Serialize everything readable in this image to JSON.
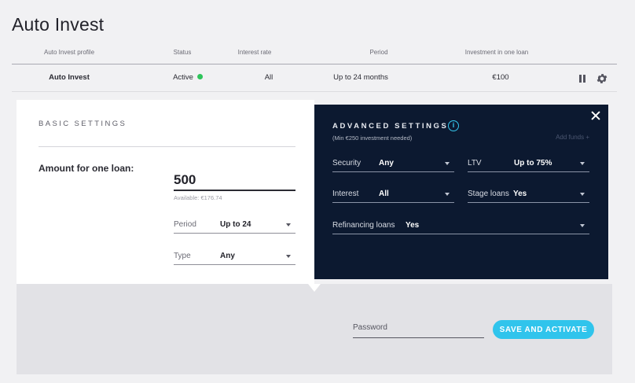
{
  "page": {
    "title": "Auto Invest"
  },
  "table": {
    "headers": [
      "Auto Invest profile",
      "Status",
      "Interest rate",
      "Period",
      "Investment in one loan"
    ],
    "row": {
      "profile": "Auto Invest",
      "status": "Active",
      "interest_rate": "All",
      "period": "Up to 24 months",
      "investment": "€100"
    },
    "status_color": "#2ec45a"
  },
  "basic": {
    "heading": "BASIC SETTINGS",
    "amount_label": "Amount for one loan:",
    "amount_value": "500",
    "available": "Available: €176.74",
    "period": {
      "label": "Period",
      "value": "Up to 24"
    },
    "type": {
      "label": "Type",
      "value": "Any"
    }
  },
  "advanced": {
    "heading": "ADVANCED SETTINGS",
    "subtitle": "(Min €250 investment needed)",
    "add_funds": "Add funds +",
    "security": {
      "label": "Security",
      "value": "Any"
    },
    "ltv": {
      "label": "LTV",
      "value": "Up to 75%"
    },
    "interest": {
      "label": "Interest",
      "value": "All"
    },
    "stage_loans": {
      "label": "Stage loans",
      "value": "Yes"
    },
    "refinancing": {
      "label": "Refinancing loans",
      "value": "Yes"
    }
  },
  "footer": {
    "password_placeholder": "Password",
    "activate_label": "SAVE AND ACTIVATE"
  },
  "colors": {
    "accent": "#30c4ec",
    "advanced_bg": "#0c1930"
  },
  "icons": [
    "pause-icon",
    "gear-icon",
    "info-icon",
    "close-icon",
    "chevron-down-icon"
  ]
}
